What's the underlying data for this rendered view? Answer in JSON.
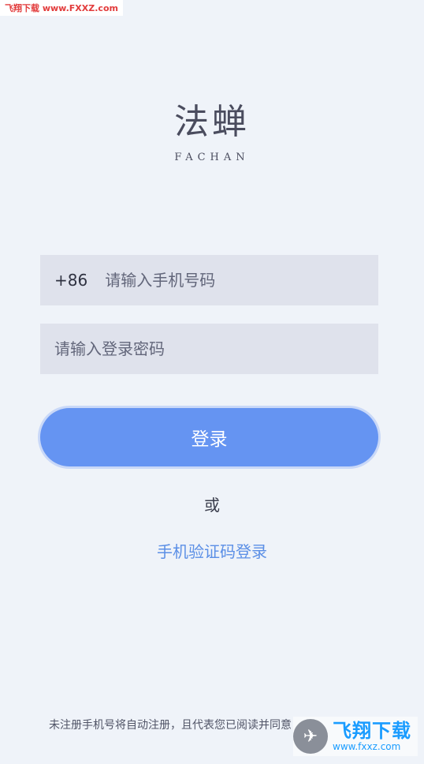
{
  "watermark_top": "飞翔下载 www.FXXZ.com",
  "logo": {
    "title": "法蝉",
    "subtitle": "FACHAN"
  },
  "phone_field": {
    "country_code": "+86",
    "placeholder": "请输入手机号码"
  },
  "password_field": {
    "placeholder": "请输入登录密码"
  },
  "login_button": "登录",
  "divider": "或",
  "sms_login_link": "手机验证码登录",
  "terms_text": "未注册手机号将自动注册，且代表您已阅读并同意",
  "watermark_bottom": {
    "brand": "飞翔下载",
    "url": "www.fxxz.com"
  },
  "colors": {
    "background": "#eff3f9",
    "accent": "#6594f2",
    "link": "#5b8fe6",
    "field_bg": "#dfe2ec"
  }
}
